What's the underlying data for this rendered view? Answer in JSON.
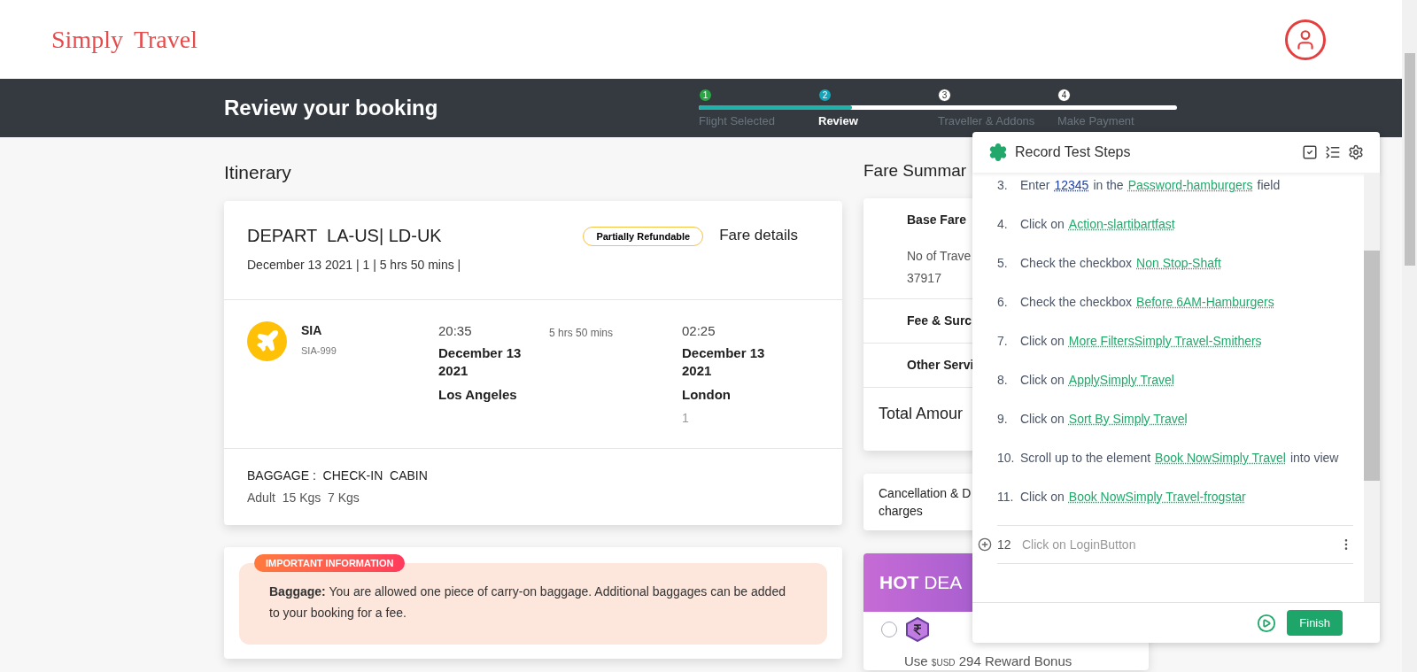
{
  "logo": {
    "word1": "Simply",
    "word2": "Travel"
  },
  "page_title": "Review your booking",
  "stepper": {
    "level": 0.32,
    "steps": [
      {
        "number": "1",
        "label": "Flight Selected",
        "completed": true,
        "selected": false
      },
      {
        "number": "2",
        "label": "Review",
        "completed": false,
        "selected": true
      },
      {
        "number": "3",
        "label": "Traveller & Addons",
        "completed": false,
        "selected": false
      },
      {
        "number": "4",
        "label": "Make Payment",
        "completed": false,
        "selected": false
      }
    ]
  },
  "itinerary": {
    "title": "Itinerary",
    "route": "DEPART  LA-US| LD-UK",
    "summary": "December 13 2021 | 1 | 5 hrs 50 mins |",
    "badge": "Partially Refundable",
    "fare_details": "Fare details",
    "airline": "SIA",
    "flight_no": "SIA-999",
    "duration": "5 hrs 50 mins",
    "depart": {
      "time": "20:35",
      "date": "December 13 2021",
      "city": "Los Angeles"
    },
    "arrive": {
      "time": "02:25",
      "date": "December 13 2021",
      "city": "London",
      "terminal": "1"
    },
    "baggage_heading": "BAGGAGE :  CHECK-IN  CABIN",
    "baggage_values": "Adult  15 Kgs  7 Kgs"
  },
  "important": {
    "tag": "IMPORTANT INFORMATION",
    "text": "**Baggage:** You are allowed one piece of carry-on baggage. Additional baggages can be added to your booking for a fee."
  },
  "fare_summary": {
    "title": "Fare Summar",
    "base_fare": "Base Fare",
    "travellers": "No of Trave",
    "amount": "37917",
    "fee": "Fee & Surc",
    "other": "Other Servi",
    "total": "Total Amour"
  },
  "cancellation": "Cancellation & D\ncharges",
  "hot_deals": {
    "bold": "HOT",
    "rest": "DEA",
    "offer_selected": false,
    "offer_prefix": "Use",
    "currency": "$USD",
    "offer_rest": "294 Reward Bonus"
  },
  "recorder": {
    "title": "Record Test Steps",
    "steps": [
      {
        "number": "3.",
        "parts": [
          {
            "kind": "text",
            "text": "Enter"
          },
          {
            "kind": "value",
            "text": "12345"
          },
          {
            "kind": "text",
            "text": "in the"
          },
          {
            "kind": "element",
            "text": "Password-hamburgers"
          },
          {
            "kind": "text",
            "text": "field"
          }
        ]
      },
      {
        "number": "4.",
        "parts": [
          {
            "kind": "text",
            "text": "Click on"
          },
          {
            "kind": "element",
            "text": "Action-slartibartfast"
          }
        ]
      },
      {
        "number": "5.",
        "parts": [
          {
            "kind": "text",
            "text": "Check the checkbox"
          },
          {
            "kind": "element",
            "text": "Non Stop-Shaft"
          }
        ]
      },
      {
        "number": "6.",
        "parts": [
          {
            "kind": "text",
            "text": "Check the checkbox"
          },
          {
            "kind": "element",
            "text": "Before 6AM-Hamburgers"
          }
        ]
      },
      {
        "number": "7.",
        "parts": [
          {
            "kind": "text",
            "text": "Click on"
          },
          {
            "kind": "element",
            "text": "More FiltersSimply Travel-Smithers"
          }
        ]
      },
      {
        "number": "8.",
        "parts": [
          {
            "kind": "text",
            "text": "Click on"
          },
          {
            "kind": "element",
            "text": "ApplySimply Travel"
          }
        ]
      },
      {
        "number": "9.",
        "parts": [
          {
            "kind": "text",
            "text": "Click on"
          },
          {
            "kind": "element",
            "text": "Sort By Simply Travel"
          }
        ]
      },
      {
        "number": "10.",
        "parts": [
          {
            "kind": "text",
            "text": "Scroll up to the element"
          },
          {
            "kind": "element",
            "text": "Book NowSimply Travel"
          },
          {
            "kind": "text",
            "text": "into view"
          }
        ]
      },
      {
        "number": "11.",
        "parts": [
          {
            "kind": "text",
            "text": "Click on"
          },
          {
            "kind": "element",
            "text": "Book NowSimply Travel-frogstar"
          }
        ]
      }
    ],
    "new_step": {
      "number": "12",
      "placeholder": "Click on LoginButton"
    },
    "finish": "Finish"
  }
}
